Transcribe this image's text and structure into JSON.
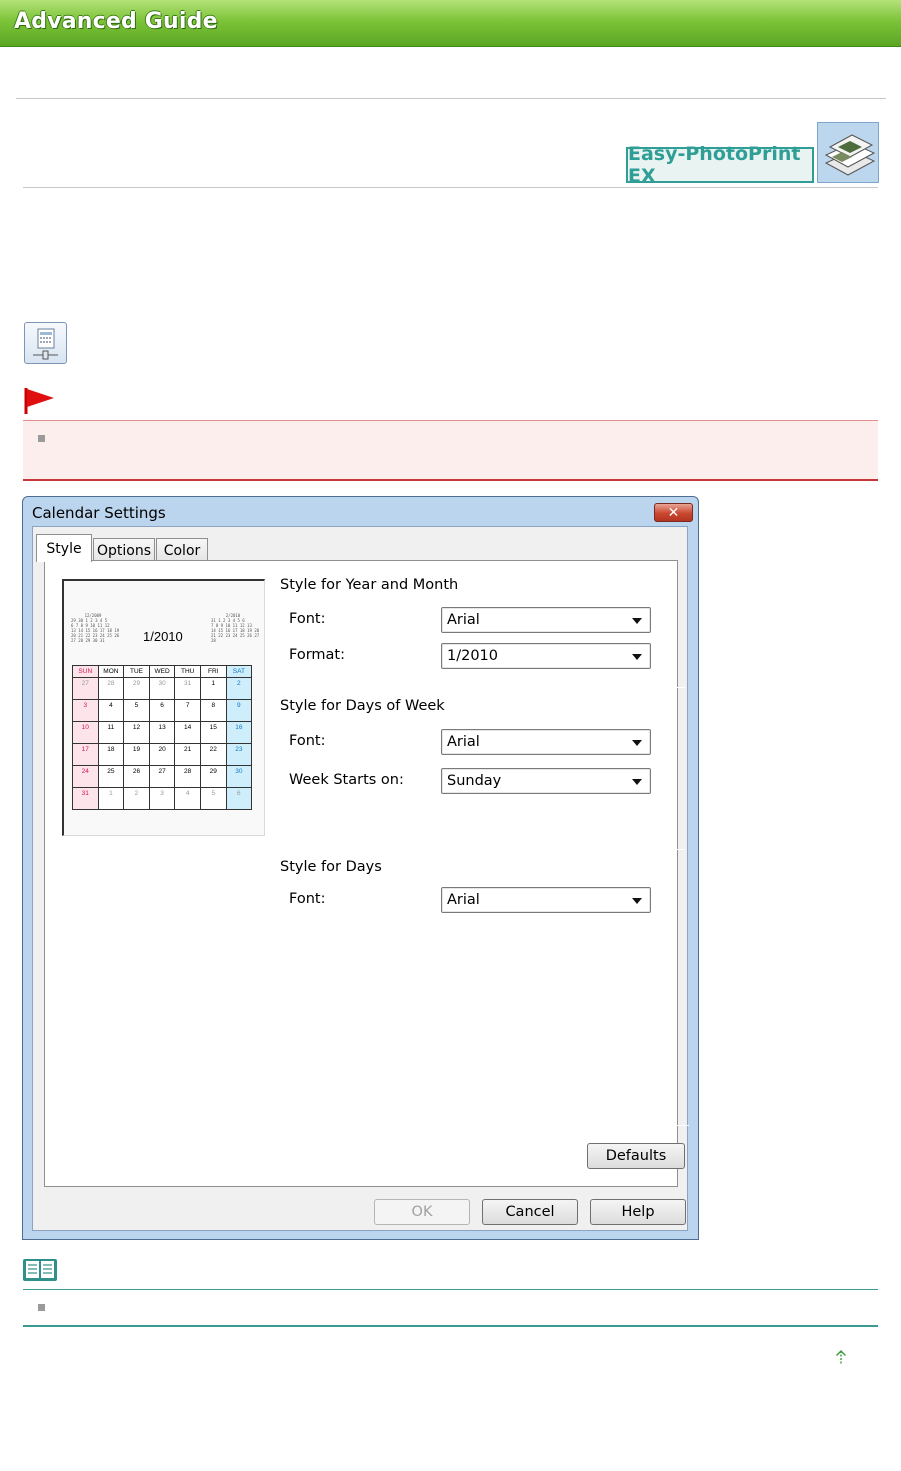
{
  "banner": {
    "title": "Advanced Guide"
  },
  "badge": {
    "product_name": "Easy-PhotoPrint EX",
    "icon": "photo-stack-icon"
  },
  "icons": {
    "calendar_settings": "calendar-settings-icon",
    "important": "red-flag-icon",
    "note": "open-book-icon",
    "back_to_top": "up-arrow-icon"
  },
  "dialog": {
    "title": "Calendar Settings",
    "close_glyph": "✕",
    "tabs": [
      {
        "label": "Style",
        "active": true
      },
      {
        "label": "Options",
        "active": false
      },
      {
        "label": "Color",
        "active": false
      }
    ],
    "preview": {
      "month_label": "1/2010",
      "prev_mini": {
        "title": "12/2009",
        "rows": [
          "29 30 1 2 3 4 5",
          "6 7 8 9 10 11 12",
          "13 14 15 16 17 18 19",
          "20 21 22 23 24 25 26",
          "27 28 29 30 31"
        ]
      },
      "next_mini": {
        "title": "2/2010",
        "rows": [
          "31 1 2 3 4 5 6",
          "7 8 9 10 11 12 13",
          "14 15 16 17 18 19 20",
          "21 22 23 24 25 26 27",
          "28"
        ]
      },
      "weekday_headers": [
        "SUN",
        "MON",
        "TUE",
        "WED",
        "THU",
        "FRI",
        "SAT"
      ],
      "weeks": [
        [
          "27",
          "28",
          "29",
          "30",
          "31",
          "1",
          "2"
        ],
        [
          "3",
          "4",
          "5",
          "6",
          "7",
          "8",
          "9"
        ],
        [
          "10",
          "11",
          "12",
          "13",
          "14",
          "15",
          "16"
        ],
        [
          "17",
          "18",
          "19",
          "20",
          "21",
          "22",
          "23"
        ],
        [
          "24",
          "25",
          "26",
          "27",
          "28",
          "29",
          "30"
        ],
        [
          "31",
          "1",
          "2",
          "3",
          "4",
          "5",
          "6"
        ]
      ]
    },
    "year_month": {
      "heading": "Style for Year and Month",
      "font_label": "Font:",
      "font_value": "Arial",
      "format_label": "Format:",
      "format_value": "1/2010"
    },
    "days_of_week": {
      "heading": "Style for Days of Week",
      "font_label": "Font:",
      "font_value": "Arial",
      "week_starts_label": "Week Starts on:",
      "week_starts_value": "Sunday"
    },
    "days": {
      "heading": "Style for Days",
      "font_label": "Font:",
      "font_value": "Arial"
    },
    "defaults_label": "Defaults",
    "ok_label": "OK",
    "cancel_label": "Cancel",
    "help_label": "Help"
  },
  "colors": {
    "banner": "#7cc438",
    "badge": "#2f9e96",
    "important_border": "#c83737",
    "sunday": "#d8134e",
    "saturday": "#1178c7"
  }
}
